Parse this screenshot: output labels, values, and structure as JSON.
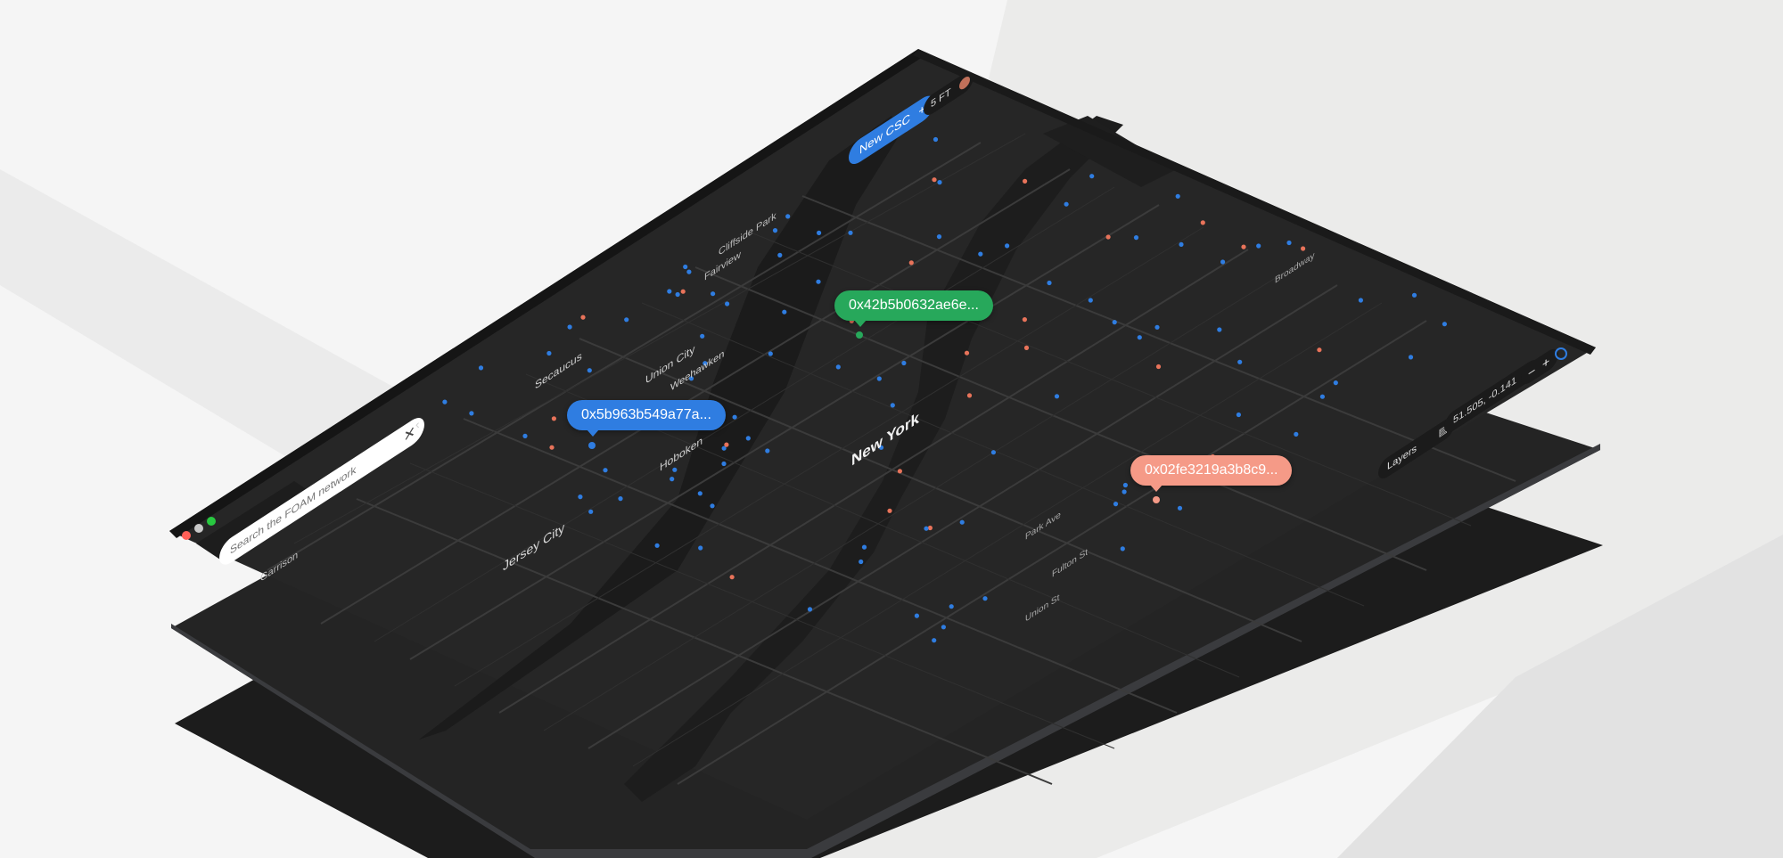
{
  "window": {
    "traffic_lights": [
      "#ff5f57",
      "#c9c9c9",
      "#28c840"
    ]
  },
  "search": {
    "placeholder": "Search the FOAM network",
    "clear_icon": "close-icon",
    "collapse_icon": "chevron-left-icon"
  },
  "toolbar": {
    "new_csc_label": "New CSC",
    "new_csc_icon": "plus-icon",
    "token_label": "5 FT",
    "avatar_icon": "avatar-icon"
  },
  "map_controls": {
    "layers_label": "Layers",
    "layers_icon": "layers-icon",
    "coordinates": "51.505, -0.141",
    "zoom_out_icon": "minus-icon",
    "zoom_in_icon": "plus-icon",
    "locate_icon": "locate-icon"
  },
  "markers": [
    {
      "label": "0x5b963b549a77a...",
      "color": "#2f7de1"
    },
    {
      "label": "0x42b5b0632ae6e...",
      "color": "#27a85b"
    },
    {
      "label": "0x02fe3219a3b8c9...",
      "color": "#f59a87"
    }
  ],
  "map_labels": {
    "city": "New York",
    "places": [
      "Jersey City",
      "Hoboken",
      "Union City",
      "Weehawken",
      "Secaucus",
      "Cliffside Park",
      "Fairview",
      "Garrison",
      "Broadway",
      "Park Ave",
      "Fulton St",
      "Union St"
    ]
  },
  "colors": {
    "map_bg": "#262626",
    "water": "#1b1b1b",
    "poi_blue": "#2f7de1",
    "poi_red": "#e8735a"
  }
}
